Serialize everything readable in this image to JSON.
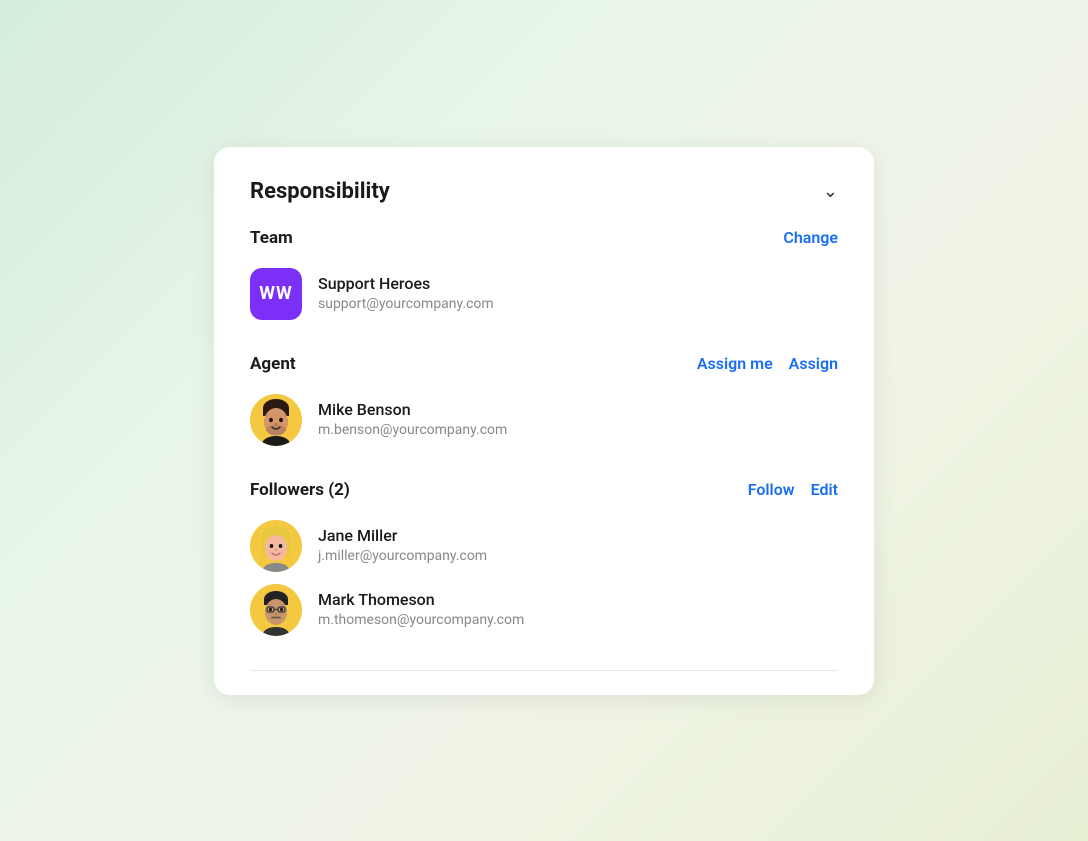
{
  "card": {
    "title": "Responsibility",
    "chevron": "chevron-down"
  },
  "team_section": {
    "label": "Team",
    "change_link": "Change",
    "team_avatar_initials": "WW",
    "team_name": "Support Heroes",
    "team_email": "support@yourcompany.com"
  },
  "agent_section": {
    "label": "Agent",
    "assign_me_link": "Assign me",
    "assign_link": "Assign",
    "agent_name": "Mike Benson",
    "agent_email": "m.benson@yourcompany.com"
  },
  "followers_section": {
    "label": "Followers (2)",
    "follow_link": "Follow",
    "edit_link": "Edit",
    "followers": [
      {
        "name": "Jane Miller",
        "email": "j.miller@yourcompany.com"
      },
      {
        "name": "Mark Thomeson",
        "email": "m.thomeson@yourcompany.com"
      }
    ]
  }
}
